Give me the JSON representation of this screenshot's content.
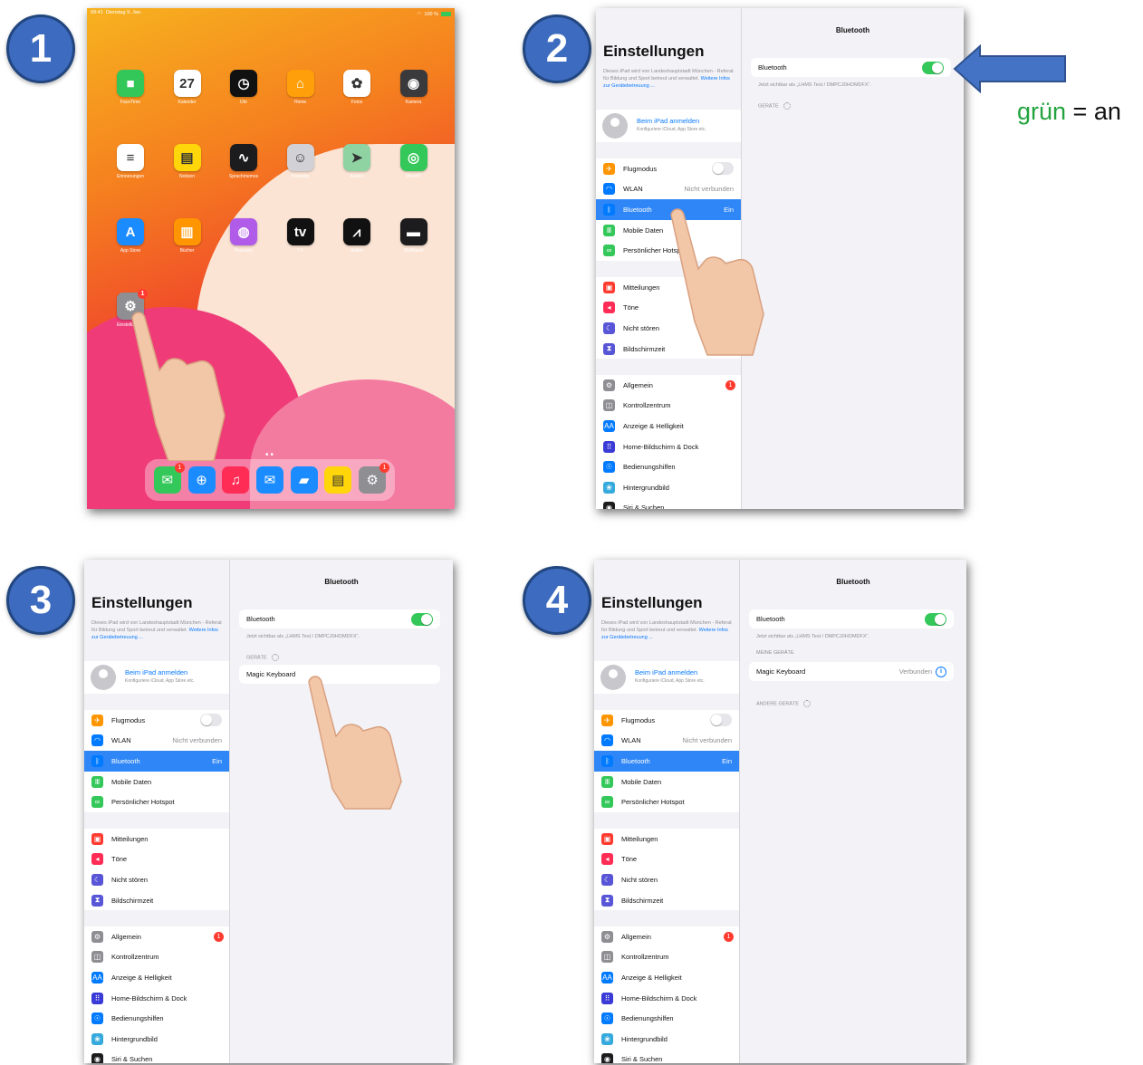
{
  "steps": [
    "1",
    "2",
    "3",
    "4"
  ],
  "status": {
    "time": "09:41",
    "date": "Dienstag 9. Jan.",
    "battery": "100 %"
  },
  "home": {
    "apps": [
      {
        "label": "FaceTime",
        "icon": "facetime-icon",
        "glyph": "■",
        "color": "#33c759"
      },
      {
        "label": "Kalender",
        "icon": "calendar-icon",
        "glyph": "27",
        "color": "#ffffff"
      },
      {
        "label": "Uhr",
        "icon": "clock-icon",
        "glyph": "◷",
        "color": "#111111"
      },
      {
        "label": "Home",
        "icon": "home-icon",
        "glyph": "⌂",
        "color": "#ff9f0a"
      },
      {
        "label": "Fotos",
        "icon": "photos-icon",
        "glyph": "✿",
        "color": "#ffffff"
      },
      {
        "label": "Kamera",
        "icon": "camera-icon",
        "glyph": "◉",
        "color": "#3a3a3c"
      },
      {
        "label": "Erinnerungen",
        "icon": "reminders-icon",
        "glyph": "≡",
        "color": "#ffffff"
      },
      {
        "label": "Notizen",
        "icon": "notes-icon",
        "glyph": "▤",
        "color": "#ffd60a"
      },
      {
        "label": "Sprachmemos",
        "icon": "voice-memos-icon",
        "glyph": "∿",
        "color": "#1c1c1e"
      },
      {
        "label": "Kontakte",
        "icon": "contacts-icon",
        "glyph": "☺",
        "color": "#d1d1d6"
      },
      {
        "label": "Karten",
        "icon": "maps-icon",
        "glyph": "➤",
        "color": "#8fd3a3"
      },
      {
        "label": "Wo ist?",
        "icon": "find-my-icon",
        "glyph": "◎",
        "color": "#34c759"
      },
      {
        "label": "App Store",
        "icon": "app-store-icon",
        "glyph": "A",
        "color": "#1a8cff"
      },
      {
        "label": "Bücher",
        "icon": "books-icon",
        "glyph": "▥",
        "color": "#ff9500"
      },
      {
        "label": "Podcasts",
        "icon": "podcasts-icon",
        "glyph": "◍",
        "color": "#b15ce8"
      },
      {
        "label": "TV",
        "icon": "tv-icon",
        "glyph": "tv",
        "color": "#111111"
      },
      {
        "label": "Aktien",
        "icon": "stocks-icon",
        "glyph": "⩘",
        "color": "#111111"
      },
      {
        "label": "Maßband",
        "icon": "measure-icon",
        "glyph": "▬",
        "color": "#1c1c1e"
      },
      {
        "label": "Einstellungen",
        "icon": "settings-icon",
        "glyph": "⚙",
        "color": "#8e8e93"
      }
    ],
    "settings_badge": "1",
    "dock": [
      {
        "icon": "messages-icon",
        "glyph": "✉",
        "color": "#34c759"
      },
      {
        "icon": "safari-icon",
        "glyph": "⊕",
        "color": "#1a8cff"
      },
      {
        "icon": "music-icon",
        "glyph": "♫",
        "color": "#ff2d55"
      },
      {
        "icon": "mail-icon",
        "glyph": "✉",
        "color": "#1a8cff"
      },
      {
        "icon": "files-icon",
        "glyph": "▰",
        "color": "#1a8cff"
      },
      {
        "icon": "notes-icon",
        "glyph": "▤",
        "color": "#ffd60a"
      },
      {
        "icon": "settings-icon",
        "glyph": "⚙",
        "color": "#8e8e93"
      }
    ],
    "dock_badges": [
      "1",
      "1"
    ]
  },
  "settings": {
    "title": "Einstellungen",
    "desc": "Dieses iPad wird von Landeshauptstadt München - Referat für Bildung und Sport betreut und verwaltet.",
    "desc_link": "Weitere Infos zur Gerätebetreuung ...",
    "account_name": "Beim iPad anmelden",
    "account_sub": "Konfiguriere iCloud, App Store etc.",
    "group1": [
      {
        "label": "Flugmodus",
        "icon": "airplane-icon",
        "glyph": "✈",
        "color": "#ff9500",
        "toggle": true
      },
      {
        "label": "WLAN",
        "icon": "wifi-icon",
        "glyph": "◠",
        "color": "#007aff",
        "value": "Nicht verbunden"
      },
      {
        "label": "Bluetooth",
        "icon": "bluetooth-icon",
        "glyph": "ᛒ",
        "color": "#007aff",
        "value": "Ein",
        "selected": true
      },
      {
        "label": "Mobile Daten",
        "icon": "cellular-icon",
        "glyph": "Ⅲ",
        "color": "#34c759"
      },
      {
        "label": "Persönlicher Hotspot",
        "icon": "hotspot-icon",
        "glyph": "∞",
        "color": "#34c759"
      }
    ],
    "group2": [
      {
        "label": "Mitteilungen",
        "icon": "notifications-icon",
        "glyph": "▣",
        "color": "#ff3b30"
      },
      {
        "label": "Töne",
        "icon": "sounds-icon",
        "glyph": "◂",
        "color": "#ff2d55"
      },
      {
        "label": "Nicht stören",
        "icon": "moon-icon",
        "glyph": "☾",
        "color": "#5856d6"
      },
      {
        "label": "Bildschirmzeit",
        "icon": "hourglass-icon",
        "glyph": "⧗",
        "color": "#5856d6"
      }
    ],
    "group3": [
      {
        "label": "Allgemein",
        "icon": "gear-icon",
        "glyph": "⚙",
        "color": "#8e8e93",
        "badge": "1"
      },
      {
        "label": "Kontrollzentrum",
        "icon": "control-center-icon",
        "glyph": "◫",
        "color": "#8e8e93"
      },
      {
        "label": "Anzeige & Helligkeit",
        "icon": "display-icon",
        "glyph": "AA",
        "color": "#007aff"
      },
      {
        "label": "Home-Bildschirm & Dock",
        "icon": "home-screen-icon",
        "glyph": "⠿",
        "color": "#3a3ad6"
      },
      {
        "label": "Bedienungshilfen",
        "icon": "accessibility-icon",
        "glyph": "☉",
        "color": "#007aff"
      },
      {
        "label": "Hintergrundbild",
        "icon": "wallpaper-icon",
        "glyph": "❀",
        "color": "#36aadc"
      },
      {
        "label": "Siri & Suchen",
        "icon": "siri-icon",
        "glyph": "◉",
        "color": "#1c1c1e"
      }
    ]
  },
  "bluetooth": {
    "header": "Bluetooth",
    "label": "Bluetooth",
    "visible_as": "Jetzt sichtbar als „LHMS Test / DMPCJ0HOMDFX“.",
    "section_devices": "GERÄTE",
    "section_my_devices": "MEINE GERÄTE",
    "section_other_devices": "ANDERE GERÄTE",
    "device": "Magic Keyboard",
    "device_status": "Verbunden",
    "info_glyph": "i"
  },
  "note": {
    "green": "grün",
    "rest": " = an"
  },
  "colors": {
    "step": "#3d6bbf",
    "arrow": "#4472c4",
    "toggle_on": "#34c759",
    "selected": "#2f86f6"
  }
}
